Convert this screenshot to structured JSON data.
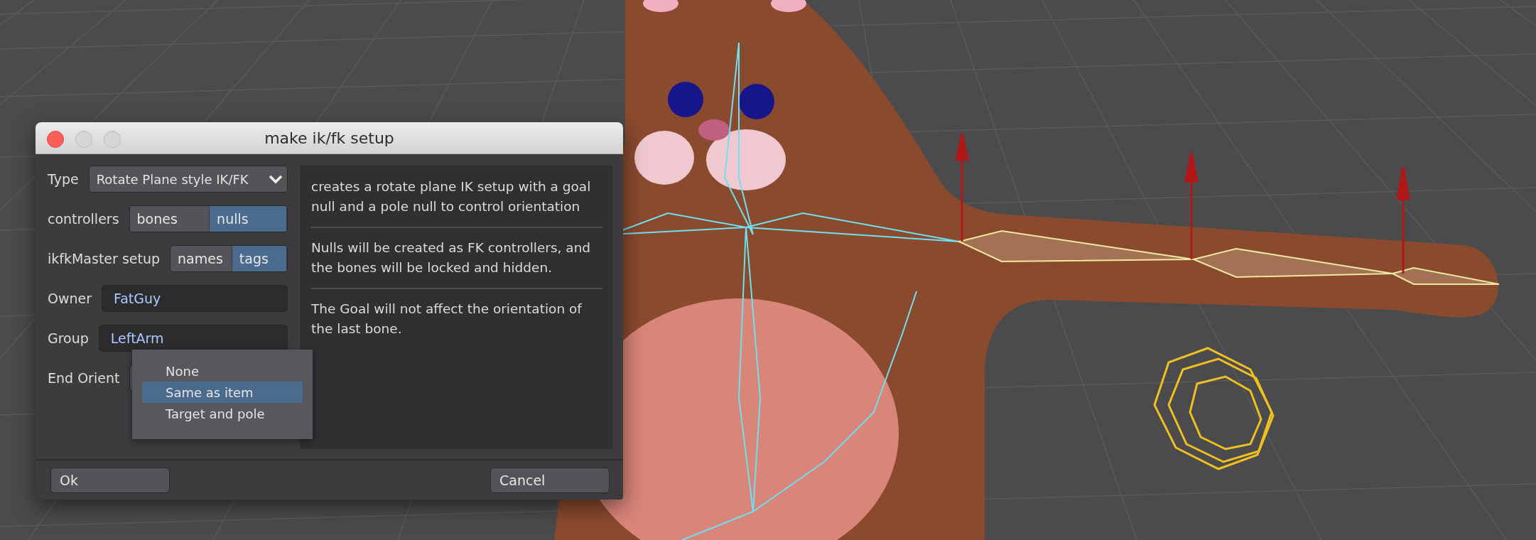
{
  "window": {
    "title": "make ik/fk setup"
  },
  "form": {
    "type": {
      "label": "Type",
      "value": "Rotate Plane style IK/FK"
    },
    "controllers": {
      "label": "controllers",
      "options": [
        {
          "label": "bones",
          "selected": false
        },
        {
          "label": "nulls",
          "selected": true
        }
      ]
    },
    "ikfk_master": {
      "label": "ikfkMaster setup",
      "options": [
        {
          "label": "names",
          "selected": false
        },
        {
          "label": "tags",
          "selected": true
        }
      ]
    },
    "owner": {
      "label": "Owner",
      "value": "FatGuy"
    },
    "group": {
      "label": "Group",
      "value": "LeftArm"
    },
    "end_orient": {
      "label": "End Orient",
      "menu": [
        {
          "label": "None",
          "selected": false
        },
        {
          "label": "Same as item",
          "selected": true
        },
        {
          "label": "Target and pole",
          "selected": false
        }
      ]
    }
  },
  "description": [
    "creates a rotate plane IK setup with a goal null and a pole null to control orientation",
    "Nulls will be created as FK controllers, and the bones will be locked and hidden.",
    "The Goal will not affect the orientation of the last bone."
  ],
  "buttons": [
    "Ok",
    "Cancel"
  ]
}
